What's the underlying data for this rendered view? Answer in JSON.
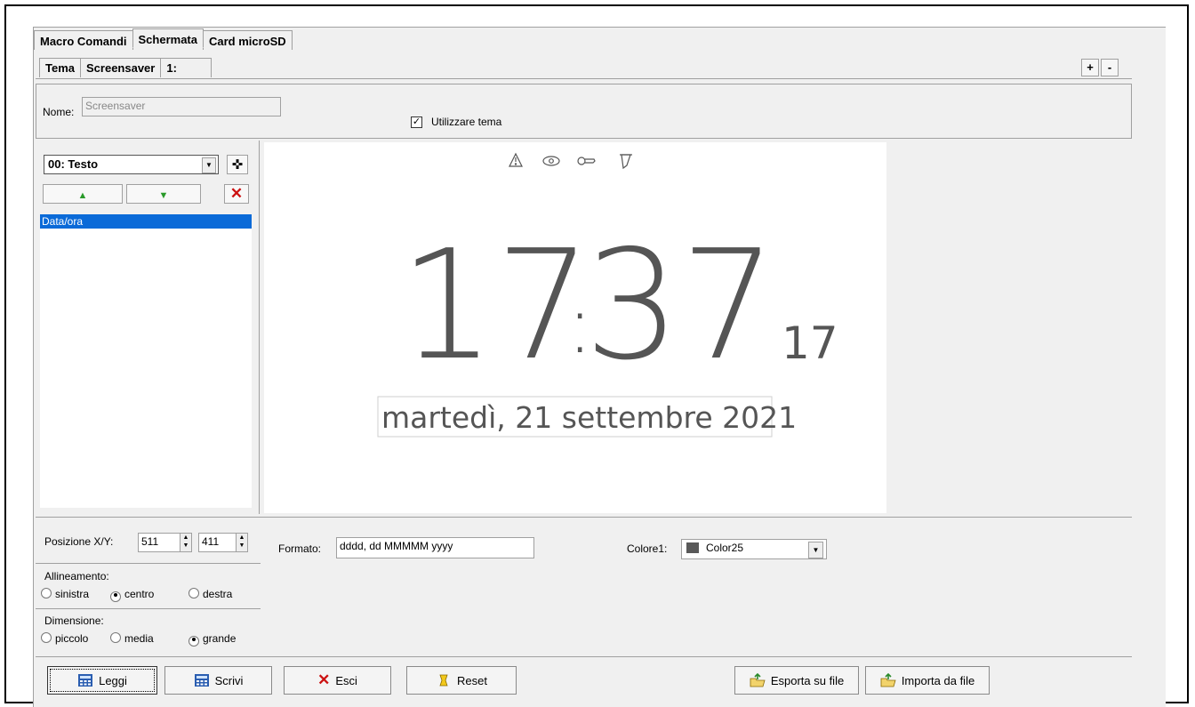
{
  "tabs_main": [
    "Macro Comandi",
    "Schermata",
    "Card microSD"
  ],
  "tabs_sub": [
    "Tema",
    "Screensaver",
    "1:"
  ],
  "plus_label": "+",
  "minus_label": "-",
  "nome_label": "Nome:",
  "nome_value": "Screensaver",
  "use_theme_label": "Utilizzare tema",
  "use_theme_checked": true,
  "element_select": "00: Testo",
  "list_items": [
    "Data/ora"
  ],
  "preview": {
    "time": "17:37",
    "time_hh": "17",
    "time_mm": "37",
    "seconds": "17",
    "date": "martedì, 21 settembre 2021",
    "status_icons": [
      "warning-icon",
      "eye-icon",
      "key-icon",
      "bell-icon"
    ]
  },
  "pos_label": "Posizione X/Y:",
  "pos_x": "511",
  "pos_y": "411",
  "formato_label": "Formato:",
  "formato_value": "dddd, dd MMMMM yyyy",
  "colore_label": "Colore1:",
  "colore_value": "Color25",
  "colore_swatch": "#595959",
  "align_label": "Allineamento:",
  "align_options": [
    "sinistra",
    "centro",
    "destra"
  ],
  "align_selected": "centro",
  "size_label": "Dimensione:",
  "size_options": [
    "piccolo",
    "media",
    "grande"
  ],
  "size_selected": "grande",
  "buttons": {
    "leggi": "Leggi",
    "scrivi": "Scrivi",
    "esci": "Esci",
    "reset": "Reset",
    "esporta": "Esporta su file",
    "importa": "Importa da file"
  }
}
